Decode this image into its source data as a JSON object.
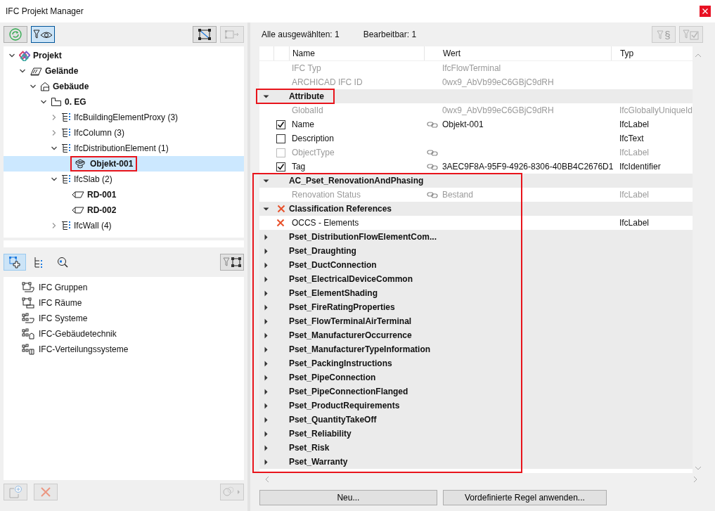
{
  "window": {
    "title": "IFC Projekt Manager"
  },
  "left_toolbar": [
    {
      "kind": "refresh",
      "pressed": false,
      "disabled": false
    },
    {
      "kind": "filter-eye",
      "pressed": true,
      "disabled": false
    },
    {
      "kind": "select-nodes",
      "pressed": false,
      "disabled": false
    },
    {
      "kind": "node-arrow",
      "pressed": false,
      "disabled": true
    }
  ],
  "tree": [
    {
      "label": "Projekt",
      "kind": "project",
      "bold": true,
      "expanded": true,
      "selected": false,
      "children": [
        {
          "label": "Gelände",
          "kind": "site",
          "bold": true,
          "expanded": true,
          "selected": false,
          "children": [
            {
              "label": "Gebäude",
              "kind": "building",
              "bold": true,
              "expanded": true,
              "selected": false,
              "children": [
                {
                  "label": "0. EG",
                  "kind": "storey",
                  "bold": true,
                  "expanded": true,
                  "selected": false,
                  "children": [
                    {
                      "label": "IfcBuildingElementProxy (3)",
                      "kind": "class",
                      "bold": false,
                      "expanded": false,
                      "selected": false
                    },
                    {
                      "label": "IfcColumn (3)",
                      "kind": "class",
                      "bold": false,
                      "expanded": false,
                      "selected": false
                    },
                    {
                      "label": "IfcDistributionElement (1)",
                      "kind": "class",
                      "bold": false,
                      "expanded": true,
                      "selected": false,
                      "children": [
                        {
                          "label": "Objekt-001",
                          "kind": "object",
                          "bold": true,
                          "selected": true,
                          "highlighted": true
                        }
                      ]
                    },
                    {
                      "label": "IfcSlab (2)",
                      "kind": "class",
                      "bold": false,
                      "expanded": true,
                      "selected": false,
                      "children": [
                        {
                          "label": "RD-001",
                          "kind": "slab",
                          "bold": true,
                          "selected": false
                        },
                        {
                          "label": "RD-002",
                          "kind": "slab",
                          "bold": true,
                          "selected": false
                        }
                      ]
                    },
                    {
                      "label": "IfcWall (4)",
                      "kind": "class",
                      "bold": false,
                      "expanded": false,
                      "selected": false
                    }
                  ]
                }
              ]
            }
          ]
        }
      ]
    }
  ],
  "view_tabs": [
    {
      "kind": "groups",
      "selected": true
    },
    {
      "kind": "hierarchy",
      "selected": false
    },
    {
      "kind": "search",
      "selected": false
    }
  ],
  "groups": [
    {
      "label": "IFC Gruppen",
      "kind": "group"
    },
    {
      "label": "IFC Räume",
      "kind": "room"
    },
    {
      "label": "IFC Systeme",
      "kind": "system"
    },
    {
      "label": "IFC-Gebäudetechnik",
      "kind": "mep"
    },
    {
      "label": "IFC-Verteilungssysteme",
      "kind": "distribution"
    }
  ],
  "left_bottom_buttons": [
    {
      "kind": "add",
      "disabled": true
    },
    {
      "kind": "delete",
      "disabled": true
    },
    {
      "kind": "link",
      "disabled": true
    }
  ],
  "selection": {
    "all_selected": "Alle ausgewählten: 1",
    "editable": "Bearbeitbar: 1"
  },
  "right_toolbar": [
    {
      "kind": "filter-paragraph",
      "glyph": "§",
      "disabled": true
    },
    {
      "kind": "filter-check",
      "disabled": true
    }
  ],
  "properties": {
    "columns": [
      "Name",
      "Wert",
      "Typ"
    ],
    "groups": [
      {
        "highlighted": false,
        "rows": [
          {
            "kind": "info",
            "name": "IFC Typ",
            "value": "IfcFlowTerminal"
          },
          {
            "kind": "info",
            "name": "ARCHICAD IFC ID",
            "value": "0wx9_AbVb99eC6GBjC9dRH"
          },
          {
            "kind": "section",
            "name": "Attribute",
            "expanded": true,
            "error": false,
            "highlighted": true
          },
          {
            "kind": "info",
            "name": "GlobalId",
            "value": "0wx9_AbVb99eC6GBjC9dRH",
            "type": "IfcGloballyUniqueId"
          },
          {
            "kind": "field",
            "name": "Name",
            "checked": true,
            "disabled": false,
            "linked": true,
            "value": "Objekt-001",
            "type": "IfcLabel"
          },
          {
            "kind": "field",
            "name": "Description",
            "checked": false,
            "disabled": false,
            "linked": false,
            "type": "IfcText"
          },
          {
            "kind": "field",
            "name": "ObjectType",
            "checked": false,
            "disabled": true,
            "linked": true,
            "type": "IfcLabel"
          },
          {
            "kind": "field",
            "name": "Tag",
            "checked": true,
            "disabled": false,
            "linked": true,
            "value": "3AEC9F8A-95F9-4926-8306-40BB4C2676D1",
            "type": "IfcIdentifier"
          }
        ]
      },
      {
        "highlighted": true,
        "rows": [
          {
            "kind": "section",
            "name": "AC_Pset_RenovationAndPhasing",
            "expanded": true,
            "error": false,
            "highlighted": false
          },
          {
            "kind": "info",
            "name": "Renovation Status",
            "linked": true,
            "value": "Bestand",
            "type": "IfcLabel"
          },
          {
            "kind": "section",
            "name": "Classification References",
            "expanded": true,
            "error": true,
            "highlighted": false
          },
          {
            "kind": "reference",
            "name": "OCCS - Elements",
            "error": true,
            "type": "IfcLabel"
          },
          {
            "kind": "section",
            "name": "Pset_DistributionFlowElementCom...",
            "expanded": false,
            "error": false,
            "highlighted": false
          },
          {
            "kind": "section",
            "name": "Pset_Draughting",
            "expanded": false,
            "error": false,
            "highlighted": false
          },
          {
            "kind": "section",
            "name": "Pset_DuctConnection",
            "expanded": false,
            "error": false,
            "highlighted": false
          },
          {
            "kind": "section",
            "name": "Pset_ElectricalDeviceCommon",
            "expanded": false,
            "error": false,
            "highlighted": false
          },
          {
            "kind": "section",
            "name": "Pset_ElementShading",
            "expanded": false,
            "error": false,
            "highlighted": false
          },
          {
            "kind": "section",
            "name": "Pset_FireRatingProperties",
            "expanded": false,
            "error": false,
            "highlighted": false
          },
          {
            "kind": "section",
            "name": "Pset_FlowTerminalAirTerminal",
            "expanded": false,
            "error": false,
            "highlighted": false
          },
          {
            "kind": "section",
            "name": "Pset_ManufacturerOccurrence",
            "expanded": false,
            "error": false,
            "highlighted": false
          },
          {
            "kind": "section",
            "name": "Pset_ManufacturerTypeInformation",
            "expanded": false,
            "error": false,
            "highlighted": false
          },
          {
            "kind": "section",
            "name": "Pset_PackingInstructions",
            "expanded": false,
            "error": false,
            "highlighted": false
          },
          {
            "kind": "section",
            "name": "Pset_PipeConnection",
            "expanded": false,
            "error": false,
            "highlighted": false
          },
          {
            "kind": "section",
            "name": "Pset_PipeConnectionFlanged",
            "expanded": false,
            "error": false,
            "highlighted": false
          },
          {
            "kind": "section",
            "name": "Pset_ProductRequirements",
            "expanded": false,
            "error": false,
            "highlighted": false
          },
          {
            "kind": "section",
            "name": "Pset_QuantityTakeOff",
            "expanded": false,
            "error": false,
            "highlighted": false
          },
          {
            "kind": "section",
            "name": "Pset_Reliability",
            "expanded": false,
            "error": false,
            "highlighted": false
          },
          {
            "kind": "section",
            "name": "Pset_Risk",
            "expanded": false,
            "error": false,
            "highlighted": false
          },
          {
            "kind": "section",
            "name": "Pset_Warranty",
            "expanded": false,
            "error": false,
            "highlighted": false
          }
        ]
      }
    ]
  },
  "bottom_buttons": [
    "Neu...",
    "Vordefinierte Regel anwenden..."
  ]
}
